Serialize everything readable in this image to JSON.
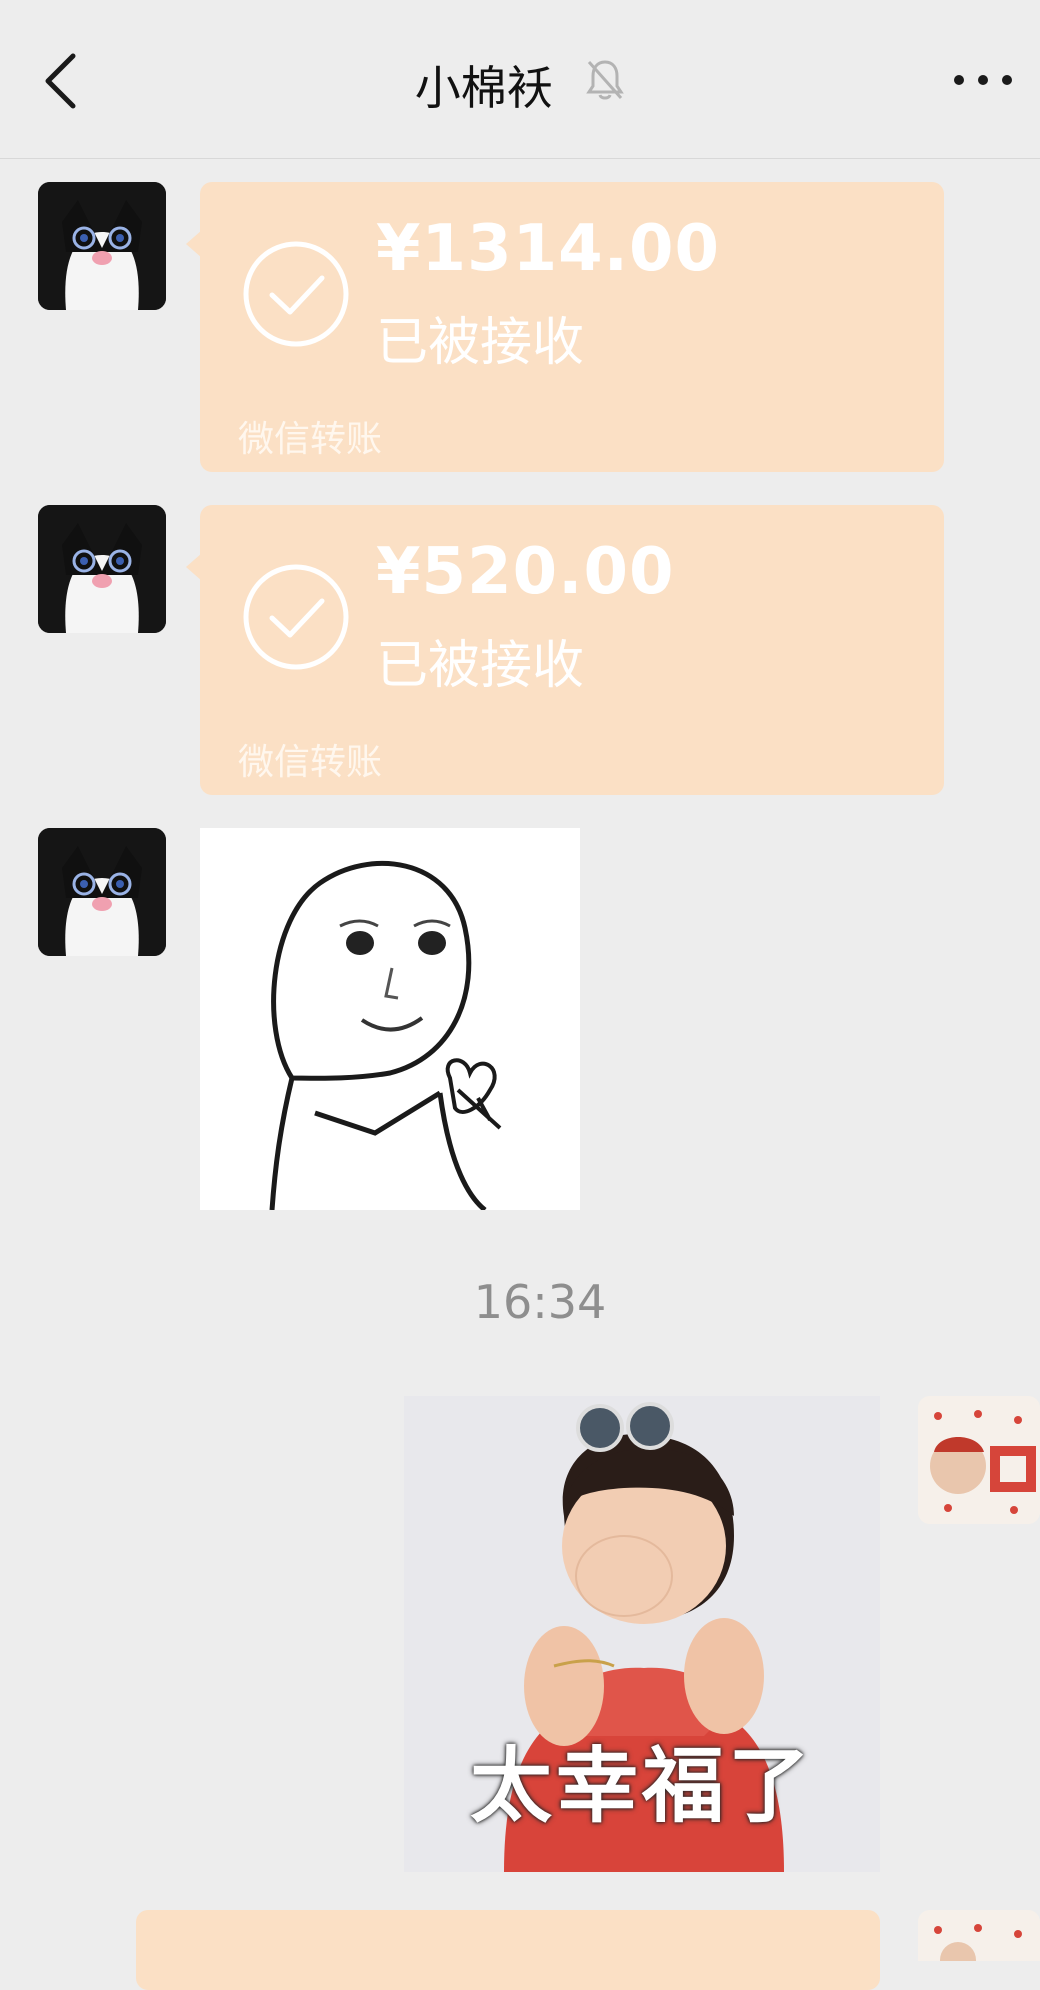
{
  "header": {
    "title": "小棉袄",
    "back_icon": "chevron-left-icon",
    "mute_icon": "bell-off-icon",
    "more_icon": "more-dots-icon"
  },
  "messages": [
    {
      "type": "transfer",
      "sender": "contact",
      "amount": "¥1314.00",
      "status": "已被接收",
      "label": "微信转账"
    },
    {
      "type": "transfer",
      "sender": "contact",
      "amount": "¥520.00",
      "status": "已被接收",
      "label": "微信转账"
    },
    {
      "type": "sticker",
      "sender": "contact",
      "description": "meme-face-heart-sticker"
    },
    {
      "type": "timestamp",
      "text": "16:34"
    },
    {
      "type": "photo",
      "sender": "me",
      "caption": "太幸福了"
    },
    {
      "type": "transfer",
      "sender": "me",
      "partial": true
    }
  ],
  "colors": {
    "background": "#ededed",
    "transfer_bubble": "#fbe0c5",
    "timestamp_text": "#8e8e8e"
  }
}
